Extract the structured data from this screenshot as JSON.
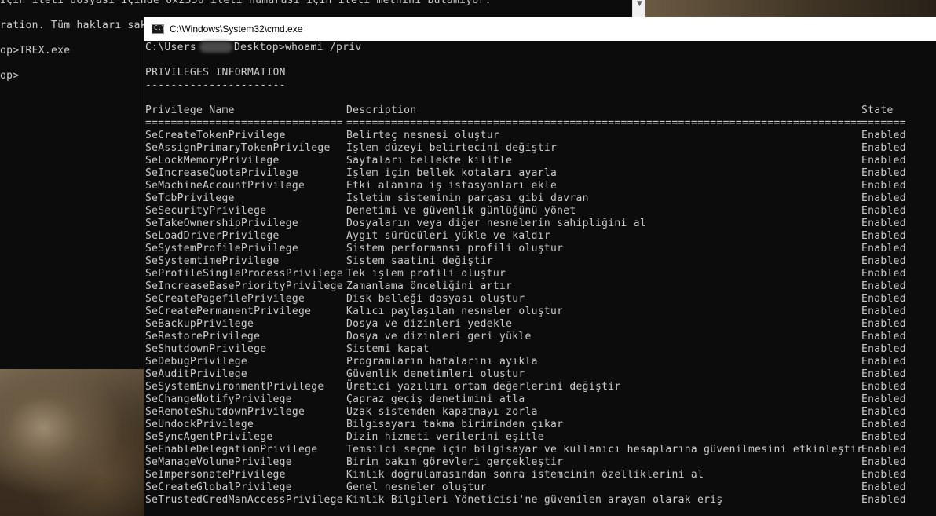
{
  "background_console": {
    "lines": [
      "İçin ileti dosyası içinde 0x2350 ileti numarası için ileti metnini bulamıyor.",
      "ration. Tüm hakları sak",
      "op>TREX.exe",
      "op>"
    ]
  },
  "window": {
    "title": "C:\\Windows\\System32\\cmd.exe",
    "icon": "cmd-icon"
  },
  "console": {
    "prompt_prefix": "C:\\Users",
    "prompt_suffix": "Desktop>whoami /priv",
    "section_title": "PRIVILEGES INFORMATION",
    "section_underline": "----------------------",
    "headers": {
      "name": "Privilege Name",
      "description": "Description",
      "state": "State"
    },
    "separators": {
      "name": "===============================",
      "description": "=================================================================================",
      "state": "======="
    },
    "privileges": [
      {
        "name": "SeCreateTokenPrivilege",
        "description": "Belirteç nesnesi oluştur",
        "state": "Enabled"
      },
      {
        "name": "SeAssignPrimaryTokenPrivilege",
        "description": "İşlem düzeyi belirtecini değiştir",
        "state": "Enabled"
      },
      {
        "name": "SeLockMemoryPrivilege",
        "description": "Sayfaları bellekte kilitle",
        "state": "Enabled"
      },
      {
        "name": "SeIncreaseQuotaPrivilege",
        "description": "İşlem için bellek kotaları ayarla",
        "state": "Enabled"
      },
      {
        "name": "SeMachineAccountPrivilege",
        "description": "Etki alanına iş istasyonları ekle",
        "state": "Enabled"
      },
      {
        "name": "SeTcbPrivilege",
        "description": "İşletim sisteminin parçası gibi davran",
        "state": "Enabled"
      },
      {
        "name": "SeSecurityPrivilege",
        "description": "Denetimi ve güvenlik günlüğünü yönet",
        "state": "Enabled"
      },
      {
        "name": "SeTakeOwnershipPrivilege",
        "description": "Dosyaların veya diğer nesnelerin sahipliğini al",
        "state": "Enabled"
      },
      {
        "name": "SeLoadDriverPrivilege",
        "description": "Aygıt sürücüleri yükle ve kaldır",
        "state": "Enabled"
      },
      {
        "name": "SeSystemProfilePrivilege",
        "description": "Sistem performansı profili oluştur",
        "state": "Enabled"
      },
      {
        "name": "SeSystemtimePrivilege",
        "description": "Sistem saatini değiştir",
        "state": "Enabled"
      },
      {
        "name": "SeProfileSingleProcessPrivilege",
        "description": "Tek işlem profili oluştur",
        "state": "Enabled"
      },
      {
        "name": "SeIncreaseBasePriorityPrivilege",
        "description": "Zamanlama önceliğini artır",
        "state": "Enabled"
      },
      {
        "name": "SeCreatePagefilePrivilege",
        "description": "Disk belleği dosyası oluştur",
        "state": "Enabled"
      },
      {
        "name": "SeCreatePermanentPrivilege",
        "description": "Kalıcı paylaşılan nesneler oluştur",
        "state": "Enabled"
      },
      {
        "name": "SeBackupPrivilege",
        "description": "Dosya ve dizinleri yedekle",
        "state": "Enabled"
      },
      {
        "name": "SeRestorePrivilege",
        "description": "Dosya ve dizinleri geri yükle",
        "state": "Enabled"
      },
      {
        "name": "SeShutdownPrivilege",
        "description": "Sistemi kapat",
        "state": "Enabled"
      },
      {
        "name": "SeDebugPrivilege",
        "description": "Programların hatalarını ayıkla",
        "state": "Enabled"
      },
      {
        "name": "SeAuditPrivilege",
        "description": "Güvenlik denetimleri oluştur",
        "state": "Enabled"
      },
      {
        "name": "SeSystemEnvironmentPrivilege",
        "description": "Üretici yazılımı ortam değerlerini değiştir",
        "state": "Enabled"
      },
      {
        "name": "SeChangeNotifyPrivilege",
        "description": "Çapraz geçiş denetimini atla",
        "state": "Enabled"
      },
      {
        "name": "SeRemoteShutdownPrivilege",
        "description": "Uzak sistemden kapatmayı zorla",
        "state": "Enabled"
      },
      {
        "name": "SeUndockPrivilege",
        "description": "Bilgisayarı takma biriminden çıkar",
        "state": "Enabled"
      },
      {
        "name": "SeSyncAgentPrivilege",
        "description": "Dizin hizmeti verilerini eşitle",
        "state": "Enabled"
      },
      {
        "name": "SeEnableDelegationPrivilege",
        "description": "Temsilci seçme için bilgisayar ve kullanıcı hesaplarına güvenilmesini etkinleştir",
        "state": "Enabled"
      },
      {
        "name": "SeManageVolumePrivilege",
        "description": "Birim bakım görevleri gerçekleştir",
        "state": "Enabled"
      },
      {
        "name": "SeImpersonatePrivilege",
        "description": "Kimlik doğrulamasından sonra istemcinin özelliklerini al",
        "state": "Enabled"
      },
      {
        "name": "SeCreateGlobalPrivilege",
        "description": "Genel nesneler oluştur",
        "state": "Enabled"
      },
      {
        "name": "SeTrustedCredManAccessPrivilege",
        "description": "Kimlik Bilgileri Yöneticisi'ne güvenilen arayan olarak eriş",
        "state": "Enabled"
      }
    ]
  }
}
